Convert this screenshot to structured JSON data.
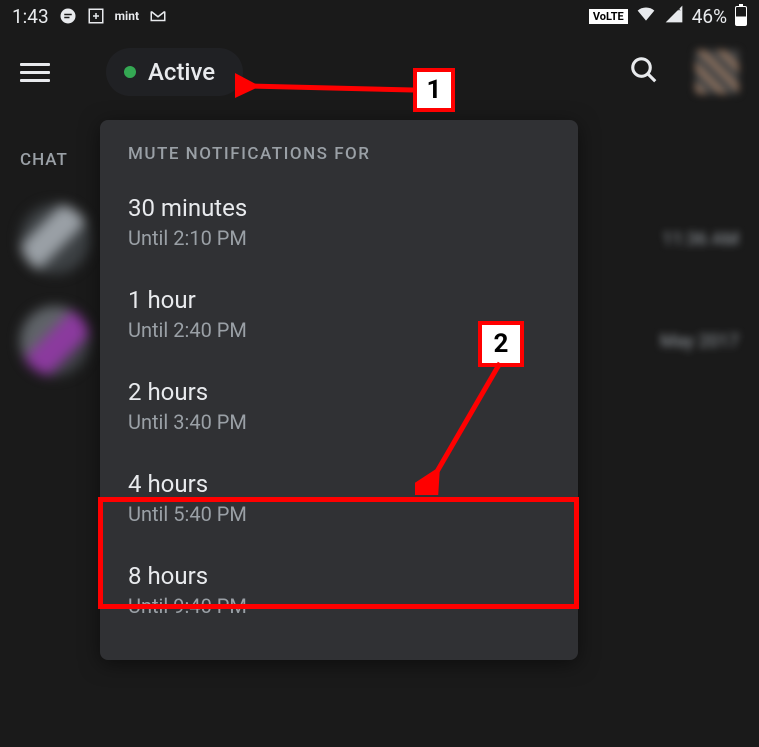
{
  "status": {
    "time": "1:43",
    "volte": "VoLTE",
    "battery_percent": "46%",
    "mint": "mint"
  },
  "header": {
    "active_label": "Active"
  },
  "section": {
    "chat_label": "CHAT"
  },
  "chat_items": [
    {
      "time_text": "11:36 AM"
    },
    {
      "time_text": "May 2017"
    }
  ],
  "popup": {
    "title": "MUTE NOTIFICATIONS FOR",
    "options": [
      {
        "label": "30 minutes",
        "sub": "Until 2:10 PM"
      },
      {
        "label": "1 hour",
        "sub": "Until 2:40 PM"
      },
      {
        "label": "2 hours",
        "sub": "Until 3:40 PM"
      },
      {
        "label": "4 hours",
        "sub": "Until 5:40 PM"
      },
      {
        "label": "8 hours",
        "sub": "Until 9:40 PM"
      }
    ]
  },
  "annotations": {
    "label_1": "1",
    "label_2": "2"
  }
}
